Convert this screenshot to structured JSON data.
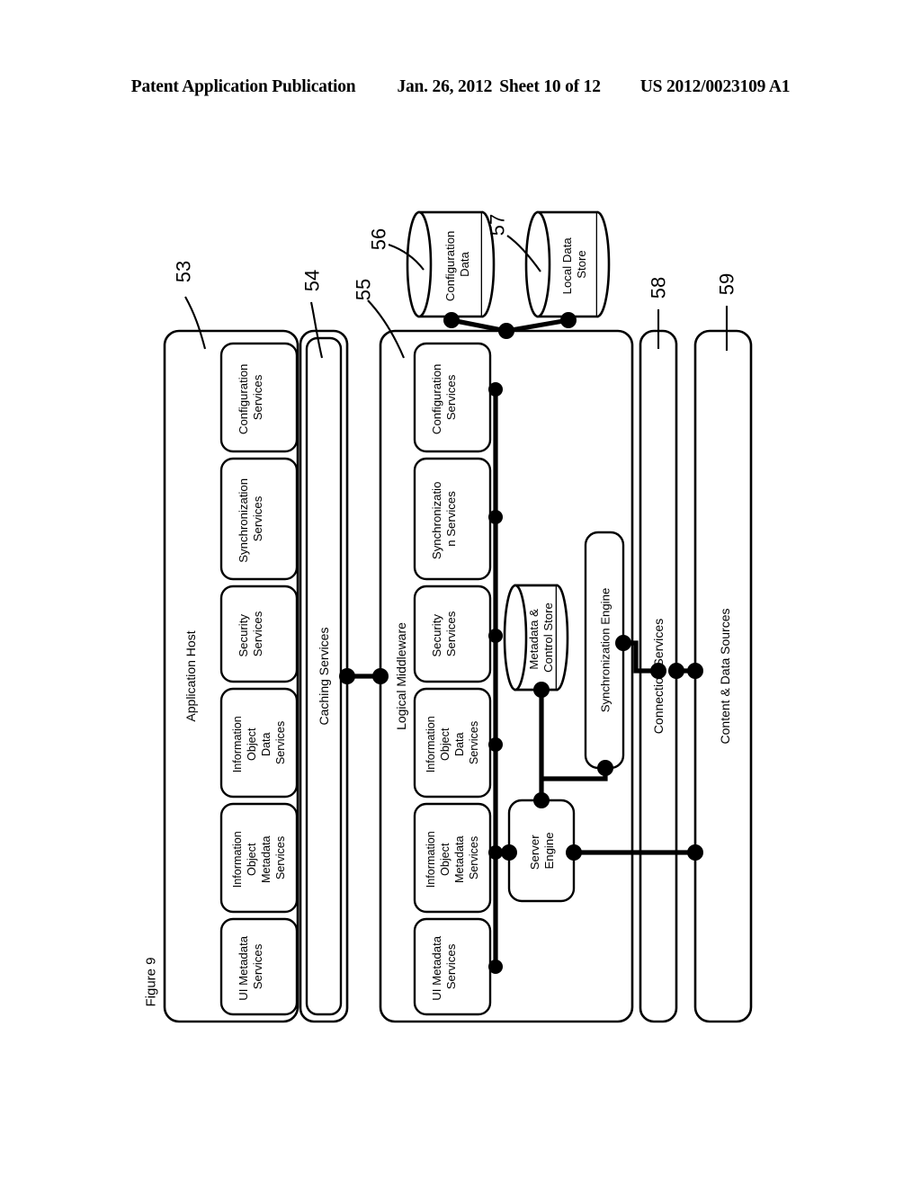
{
  "header": {
    "publication": "Patent Application Publication",
    "date": "Jan. 26, 2012",
    "sheet": "Sheet 10 of 12",
    "docnum": "US 2012/0023109 A1"
  },
  "figure": {
    "label": "Figure 9"
  },
  "refnums": {
    "application_host": "53",
    "caching_services": "54",
    "logical_middleware": "55",
    "configuration_data": "56",
    "local_data_store": "57",
    "connection_services": "58",
    "content_data_sources": "59"
  },
  "containers": {
    "application_host": "Application Host",
    "caching_services": "Caching Services",
    "logical_middleware": "Logical Middleware",
    "connection_services": "Connection Services",
    "content_data_sources": "Content & Data Sources"
  },
  "app_host_services": [
    {
      "lines": [
        "UI Metadata",
        "Services"
      ]
    },
    {
      "lines": [
        "Information",
        "Object",
        "Metadata",
        "Services"
      ]
    },
    {
      "lines": [
        "Information",
        "Object",
        "Data",
        "Services"
      ]
    },
    {
      "lines": [
        "Security",
        "Services"
      ]
    },
    {
      "lines": [
        "Synchronization",
        "Services"
      ]
    },
    {
      "lines": [
        "Configuration",
        "Services"
      ]
    }
  ],
  "middleware_services": [
    {
      "lines": [
        "UI Metadata",
        "Services"
      ]
    },
    {
      "lines": [
        "Information",
        "Object",
        "Metadata",
        "Services"
      ]
    },
    {
      "lines": [
        "Information",
        "Object",
        "Data",
        "Services"
      ]
    },
    {
      "lines": [
        "Security",
        "Services"
      ]
    },
    {
      "lines": [
        "Synchronizatio",
        "n Services"
      ]
    },
    {
      "lines": [
        "Configuration",
        "Services"
      ]
    }
  ],
  "datastores": {
    "configuration_data": [
      "Configuration",
      "Data"
    ],
    "local_data_store": [
      "Local Data",
      "Store"
    ],
    "metadata_control_store": [
      "Metadata &",
      "Control Store"
    ]
  },
  "engines": {
    "server_engine": [
      "Server",
      "Engine"
    ],
    "synchronization_engine": [
      "Synchronization Engine"
    ]
  },
  "colors": {
    "ink": "#000000",
    "paper": "#ffffff"
  }
}
